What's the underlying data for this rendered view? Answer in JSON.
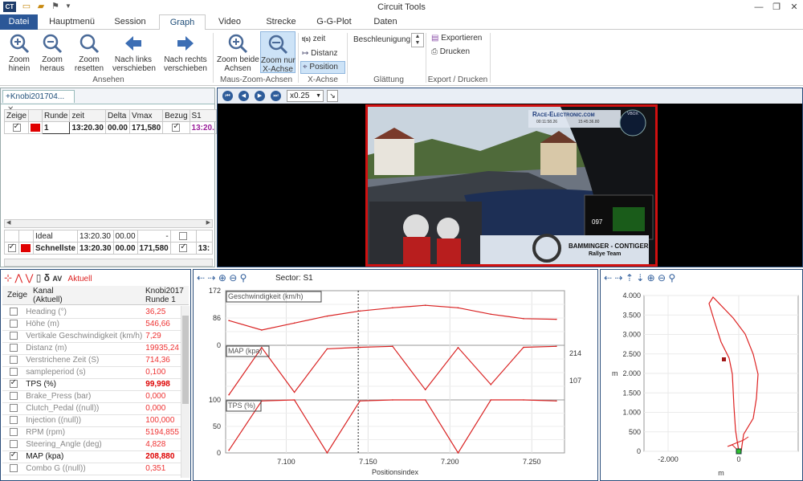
{
  "window": {
    "title": "Circuit Tools",
    "app_icon": "CT"
  },
  "ribbon_tabs": [
    {
      "id": "datei",
      "label": "Datei"
    },
    {
      "id": "haupt",
      "label": "Hauptmenü"
    },
    {
      "id": "session",
      "label": "Session"
    },
    {
      "id": "graph",
      "label": "Graph"
    },
    {
      "id": "video",
      "label": "Video"
    },
    {
      "id": "strecke",
      "label": "Strecke"
    },
    {
      "id": "ggplot",
      "label": "G-G-Plot"
    },
    {
      "id": "daten",
      "label": "Daten"
    }
  ],
  "ribbon": {
    "ansehen": {
      "group": "Ansehen",
      "zoom_in": "Zoom\nhinein",
      "zoom_out": "Zoom\nheraus",
      "zoom_reset": "Zoom\nresetten",
      "left": "Nach links\nverschieben",
      "right": "Nach rechts\nverschieben"
    },
    "maus": {
      "group": "Maus-Zoom-Achsen",
      "both": "Zoom beide\nAchsen",
      "x": "Zoom nur\nX-Achse"
    },
    "xachse": {
      "group": "X-Achse",
      "zeit": "zeit",
      "zeit_icon": "t(s)",
      "distanz": "Distanz",
      "position": "Position"
    },
    "glaettung": {
      "group": "Glättung",
      "label": "Beschleunigung"
    },
    "export": {
      "group": "Export / Drucken",
      "export": "Exportieren",
      "print": "Drucken"
    }
  },
  "laps": {
    "tab": "+Knobi201704...",
    "headers": [
      "Zeige",
      "Runde",
      "zeit",
      "Delta",
      "Vmax",
      "Bezug",
      "S1"
    ],
    "row": {
      "runde": "1",
      "zeit": "13:20.30",
      "delta": "00.00",
      "vmax": "171,580",
      "s1": "13:20."
    },
    "summary": [
      {
        "name": "Ideal",
        "zeit": "13:20.30",
        "delta": "00.00",
        "vmax": "-"
      },
      {
        "name": "Schnellste",
        "zeit": "13:20.30",
        "delta": "00.00",
        "vmax": "171,580",
        "s1": "13:"
      }
    ]
  },
  "video": {
    "speed": "x0.25",
    "brand": "Race-Electronic.com",
    "sub1": "00:11:58.26",
    "sub2": "15:45:36.80",
    "team": "BAMMINGER - CONTIGER",
    "team2": "Rallye Team",
    "speed_readout": "097",
    "vbox": "VBOX"
  },
  "channels": {
    "toolbar_label": "Aktuell",
    "headers": {
      "zeige": "Zeige",
      "kanal": "Kanal\n(Aktuell)",
      "col": "Knobi2017\nRunde 1"
    },
    "rows": [
      {
        "name": "Heading (°)",
        "value": "36,25",
        "on": false
      },
      {
        "name": "Höhe (m)",
        "value": "546,66",
        "on": false
      },
      {
        "name": "Vertikale Geschwindigkeit (km/h)",
        "value": "7,29",
        "on": false
      },
      {
        "name": "Distanz (m)",
        "value": "19935,24",
        "on": false
      },
      {
        "name": "Verstrichene Zeit (S)",
        "value": "714,36",
        "on": false
      },
      {
        "name": "sampleperiod (s)",
        "value": "0,100",
        "on": false
      },
      {
        "name": "TPS (%)",
        "value": "99,998",
        "on": true
      },
      {
        "name": "Brake_Press (bar)",
        "value": "0,000",
        "on": false
      },
      {
        "name": "Clutch_Pedal ((null))",
        "value": "0,000",
        "on": false
      },
      {
        "name": "Injection ((null))",
        "value": "100,000",
        "on": false
      },
      {
        "name": "RPM (rpm)",
        "value": "5194,855",
        "on": false
      },
      {
        "name": "Steering_Angle (deg)",
        "value": "4,828",
        "on": false
      },
      {
        "name": "MAP (kpa)",
        "value": "208,880",
        "on": true
      },
      {
        "name": "Combo G ((null))",
        "value": "0,351",
        "on": false
      }
    ]
  },
  "graph": {
    "sector": "Sector: S1",
    "xlabel": "Positionsindex",
    "xticks": [
      "7.100",
      "7.150",
      "7.200",
      "7.250"
    ],
    "panels": [
      {
        "label": "Geschwindigkeit (km/h)",
        "ticks": [
          "172",
          "86",
          "0"
        ]
      },
      {
        "label": "MAP (kpa)",
        "ticks": [
          "214",
          "107"
        ]
      },
      {
        "label": "TPS (%)",
        "ticks": [
          "100",
          "50",
          "0"
        ]
      }
    ]
  },
  "map": {
    "xlabel": "m",
    "ylabel": "m",
    "yticks": [
      "4.000",
      "3.500",
      "3.000",
      "2.500",
      "2.000",
      "1.500",
      "1.000",
      "500",
      "0"
    ],
    "xticks": [
      "-2.000",
      "0"
    ]
  },
  "chart_data": {
    "type": "line",
    "xlabel": "Positionsindex",
    "x": [
      7.065,
      7.085,
      7.105,
      7.125,
      7.145,
      7.165,
      7.185,
      7.205,
      7.225,
      7.245,
      7.265
    ],
    "series": [
      {
        "name": "Geschwindigkeit (km/h)",
        "ylim": [
          0,
          172
        ],
        "values": [
          78,
          48,
          70,
          92,
          108,
          118,
          126,
          118,
          98,
          84,
          82
        ]
      },
      {
        "name": "MAP (kpa)",
        "ylim": [
          0,
          214
        ],
        "values": [
          20,
          205,
          30,
          200,
          206,
          210,
          40,
          205,
          60,
          206,
          210
        ]
      },
      {
        "name": "TPS (%)",
        "ylim": [
          0,
          100
        ],
        "values": [
          5,
          98,
          100,
          0,
          98,
          100,
          100,
          0,
          100,
          100,
          98
        ]
      }
    ]
  }
}
